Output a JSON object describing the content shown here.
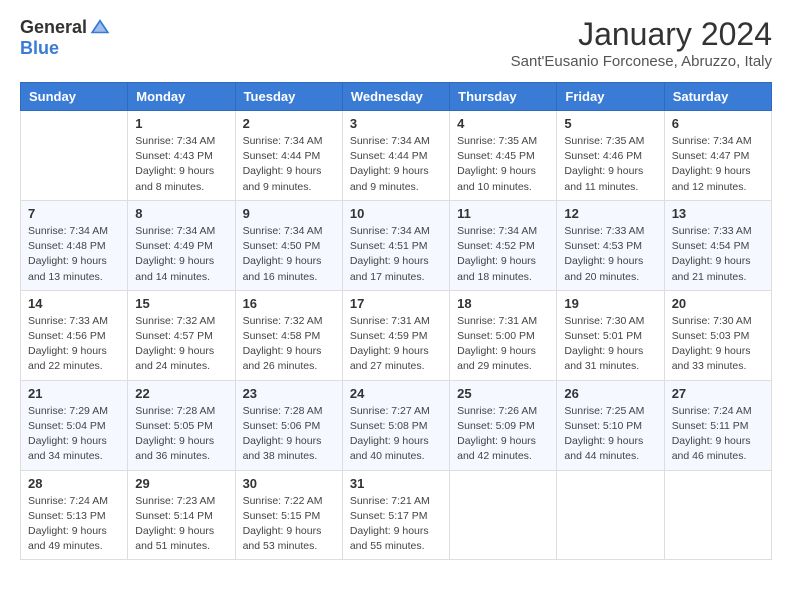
{
  "logo": {
    "general": "General",
    "blue": "Blue"
  },
  "header": {
    "month_title": "January 2024",
    "subtitle": "Sant'Eusanio Forconese, Abruzzo, Italy"
  },
  "weekdays": [
    "Sunday",
    "Monday",
    "Tuesday",
    "Wednesday",
    "Thursday",
    "Friday",
    "Saturday"
  ],
  "weeks": [
    [
      {
        "day": "",
        "info": ""
      },
      {
        "day": "1",
        "info": "Sunrise: 7:34 AM\nSunset: 4:43 PM\nDaylight: 9 hours\nand 8 minutes."
      },
      {
        "day": "2",
        "info": "Sunrise: 7:34 AM\nSunset: 4:44 PM\nDaylight: 9 hours\nand 9 minutes."
      },
      {
        "day": "3",
        "info": "Sunrise: 7:34 AM\nSunset: 4:44 PM\nDaylight: 9 hours\nand 9 minutes."
      },
      {
        "day": "4",
        "info": "Sunrise: 7:35 AM\nSunset: 4:45 PM\nDaylight: 9 hours\nand 10 minutes."
      },
      {
        "day": "5",
        "info": "Sunrise: 7:35 AM\nSunset: 4:46 PM\nDaylight: 9 hours\nand 11 minutes."
      },
      {
        "day": "6",
        "info": "Sunrise: 7:34 AM\nSunset: 4:47 PM\nDaylight: 9 hours\nand 12 minutes."
      }
    ],
    [
      {
        "day": "7",
        "info": "Sunrise: 7:34 AM\nSunset: 4:48 PM\nDaylight: 9 hours\nand 13 minutes."
      },
      {
        "day": "8",
        "info": "Sunrise: 7:34 AM\nSunset: 4:49 PM\nDaylight: 9 hours\nand 14 minutes."
      },
      {
        "day": "9",
        "info": "Sunrise: 7:34 AM\nSunset: 4:50 PM\nDaylight: 9 hours\nand 16 minutes."
      },
      {
        "day": "10",
        "info": "Sunrise: 7:34 AM\nSunset: 4:51 PM\nDaylight: 9 hours\nand 17 minutes."
      },
      {
        "day": "11",
        "info": "Sunrise: 7:34 AM\nSunset: 4:52 PM\nDaylight: 9 hours\nand 18 minutes."
      },
      {
        "day": "12",
        "info": "Sunrise: 7:33 AM\nSunset: 4:53 PM\nDaylight: 9 hours\nand 20 minutes."
      },
      {
        "day": "13",
        "info": "Sunrise: 7:33 AM\nSunset: 4:54 PM\nDaylight: 9 hours\nand 21 minutes."
      }
    ],
    [
      {
        "day": "14",
        "info": "Sunrise: 7:33 AM\nSunset: 4:56 PM\nDaylight: 9 hours\nand 22 minutes."
      },
      {
        "day": "15",
        "info": "Sunrise: 7:32 AM\nSunset: 4:57 PM\nDaylight: 9 hours\nand 24 minutes."
      },
      {
        "day": "16",
        "info": "Sunrise: 7:32 AM\nSunset: 4:58 PM\nDaylight: 9 hours\nand 26 minutes."
      },
      {
        "day": "17",
        "info": "Sunrise: 7:31 AM\nSunset: 4:59 PM\nDaylight: 9 hours\nand 27 minutes."
      },
      {
        "day": "18",
        "info": "Sunrise: 7:31 AM\nSunset: 5:00 PM\nDaylight: 9 hours\nand 29 minutes."
      },
      {
        "day": "19",
        "info": "Sunrise: 7:30 AM\nSunset: 5:01 PM\nDaylight: 9 hours\nand 31 minutes."
      },
      {
        "day": "20",
        "info": "Sunrise: 7:30 AM\nSunset: 5:03 PM\nDaylight: 9 hours\nand 33 minutes."
      }
    ],
    [
      {
        "day": "21",
        "info": "Sunrise: 7:29 AM\nSunset: 5:04 PM\nDaylight: 9 hours\nand 34 minutes."
      },
      {
        "day": "22",
        "info": "Sunrise: 7:28 AM\nSunset: 5:05 PM\nDaylight: 9 hours\nand 36 minutes."
      },
      {
        "day": "23",
        "info": "Sunrise: 7:28 AM\nSunset: 5:06 PM\nDaylight: 9 hours\nand 38 minutes."
      },
      {
        "day": "24",
        "info": "Sunrise: 7:27 AM\nSunset: 5:08 PM\nDaylight: 9 hours\nand 40 minutes."
      },
      {
        "day": "25",
        "info": "Sunrise: 7:26 AM\nSunset: 5:09 PM\nDaylight: 9 hours\nand 42 minutes."
      },
      {
        "day": "26",
        "info": "Sunrise: 7:25 AM\nSunset: 5:10 PM\nDaylight: 9 hours\nand 44 minutes."
      },
      {
        "day": "27",
        "info": "Sunrise: 7:24 AM\nSunset: 5:11 PM\nDaylight: 9 hours\nand 46 minutes."
      }
    ],
    [
      {
        "day": "28",
        "info": "Sunrise: 7:24 AM\nSunset: 5:13 PM\nDaylight: 9 hours\nand 49 minutes."
      },
      {
        "day": "29",
        "info": "Sunrise: 7:23 AM\nSunset: 5:14 PM\nDaylight: 9 hours\nand 51 minutes."
      },
      {
        "day": "30",
        "info": "Sunrise: 7:22 AM\nSunset: 5:15 PM\nDaylight: 9 hours\nand 53 minutes."
      },
      {
        "day": "31",
        "info": "Sunrise: 7:21 AM\nSunset: 5:17 PM\nDaylight: 9 hours\nand 55 minutes."
      },
      {
        "day": "",
        "info": ""
      },
      {
        "day": "",
        "info": ""
      },
      {
        "day": "",
        "info": ""
      }
    ]
  ]
}
